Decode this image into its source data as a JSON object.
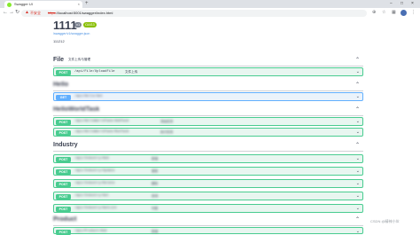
{
  "browser": {
    "tab_title": "Swagger UI",
    "tab_close": "×",
    "new_tab": "+",
    "win_min": "−",
    "win_max": "□",
    "win_close": "×",
    "back": "←",
    "forward": "→",
    "reload": "↻",
    "security_warning": "不安全",
    "url_scheme": "https",
    "url_rest": "://localhost:5001/swagger/index.html"
  },
  "api": {
    "title": "1111",
    "version": "v1",
    "oas": "OAS3",
    "spec_url": "/swagger/v1/swagger.json",
    "description": "111212"
  },
  "sections": [
    {
      "name": "File",
      "description": "文件上传与管理",
      "ops": [
        {
          "method": "POST",
          "path": "/api/File/UploadFile",
          "summary": "文件上传"
        }
      ]
    },
    {
      "name": "Hello",
      "description": "",
      "ops": [
        {
          "method": "GET",
          "path": "/api/Hello/Get",
          "summary": ""
        }
      ]
    },
    {
      "name": "HelloWorldTask",
      "description": "",
      "ops": [
        {
          "method": "POST",
          "path": "/api/HelloWorldTask/AddTask",
          "summary": "添加任务"
        },
        {
          "method": "POST",
          "path": "/api/HelloWorldTask/RunTask",
          "summary": "执行任务"
        }
      ]
    },
    {
      "name": "Industry",
      "description": "",
      "ops": [
        {
          "method": "POST",
          "path": "/api/Industry/Add",
          "summary": "新增"
        },
        {
          "method": "POST",
          "path": "/api/Industry/Update",
          "summary": "更新"
        },
        {
          "method": "POST",
          "path": "/api/Industry/Delete",
          "summary": "删除"
        },
        {
          "method": "POST",
          "path": "/api/Industry/Get",
          "summary": "查询"
        },
        {
          "method": "POST",
          "path": "/api/Industry/GetList",
          "summary": "列表"
        }
      ]
    },
    {
      "name": "Product",
      "description": "",
      "ops": [
        {
          "method": "POST",
          "path": "/api/Product/Add",
          "summary": "新增"
        }
      ]
    }
  ],
  "colors": {
    "post": "#49cc90",
    "get": "#61affe",
    "version_badge": "#7d8492",
    "oas_badge": "#89bf04"
  },
  "watermark": "CSDN @精神小伙"
}
